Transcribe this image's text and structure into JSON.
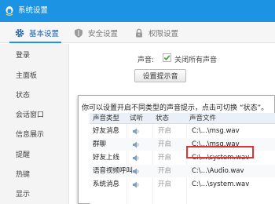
{
  "window": {
    "title": "系统设置"
  },
  "tabs": [
    {
      "label": "基本设置",
      "icon": "gear-icon",
      "active": true
    },
    {
      "label": "安全设置",
      "icon": "shield-icon",
      "active": false
    },
    {
      "label": "权限设置",
      "icon": "lock-icon",
      "active": false
    }
  ],
  "sidebar": {
    "items": [
      {
        "label": "登录"
      },
      {
        "label": "主面板"
      },
      {
        "label": "状态"
      },
      {
        "label": "会话窗口"
      },
      {
        "label": "信息展示"
      },
      {
        "label": "提醒"
      },
      {
        "label": "热键"
      },
      {
        "label": "显示"
      }
    ]
  },
  "sound": {
    "label": "声音:",
    "mute_label": "关闭所有声音",
    "mute_checked": true,
    "set_button": "设置提示音"
  },
  "popup": {
    "hint": "你可以设置开启不同类型的声音提示，点击可切换 “状态”。",
    "headers": {
      "type": "声音类型",
      "play": "试听",
      "state": "状态",
      "file": "声音文件"
    },
    "rows": [
      {
        "type": "好友消息",
        "state": "开启",
        "file": "C:\\...\\msg.wav"
      },
      {
        "type": "群聊",
        "state": "开启",
        "file": "C:\\...\\msg.wav"
      },
      {
        "type": "好友上线",
        "state": "开启",
        "file": "C:\\...\\system.wav",
        "highlighted": true
      },
      {
        "type": "语音视频呼叫",
        "state": "开启",
        "file": "C:\\...\\Audio.wav"
      },
      {
        "type": "系统消息",
        "state": "开启",
        "file": "C:\\...\\system.wav"
      }
    ]
  },
  "colors": {
    "accent": "#1c93e3",
    "highlight_border": "#e03333",
    "check": "#3aa832"
  }
}
